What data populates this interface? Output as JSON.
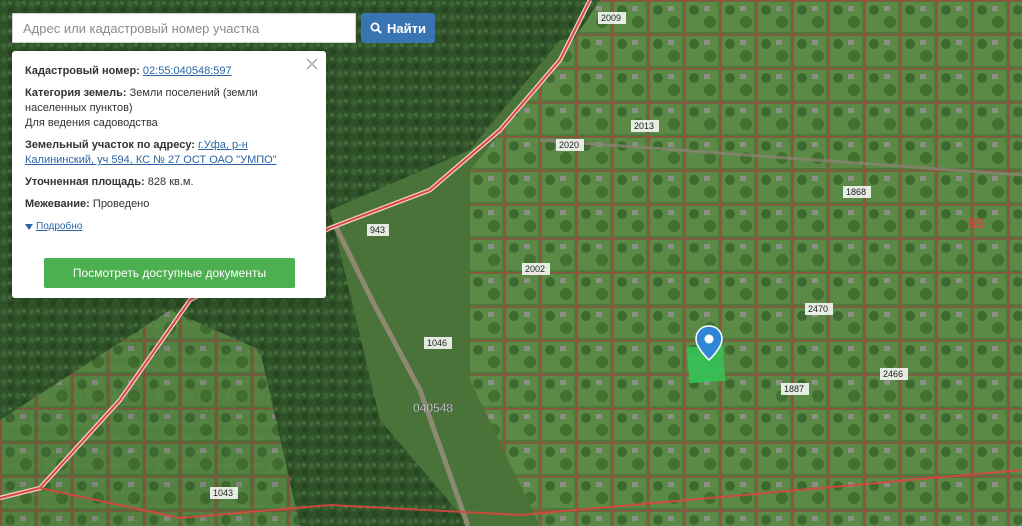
{
  "search": {
    "placeholder": "Адрес или кадастровый номер участка",
    "button_label": "Найти",
    "button_icon": "search-icon"
  },
  "panel": {
    "cadastral_label": "Кадастровый номер:",
    "cadastral_value": "02:55:040548:597",
    "category_label": "Категория земель:",
    "category_value": "Земли поселений (земли населенных пунктов)",
    "use_value": "Для ведения садоводства",
    "address_label": "Земельный участок по адресу:",
    "address_value": "г.Уфа, р-н Калининский, уч 594, КС № 27 ОСТ ОАО \"УМПО\"",
    "area_label": "Уточненная площадь:",
    "area_value": "828 кв.м.",
    "survey_label": "Межевание:",
    "survey_value": "Проведено",
    "more_label": "Подробно",
    "docs_button": "Посмотреть доступные документы",
    "close_icon": "close-icon"
  },
  "map": {
    "quarter_label": "040548",
    "district_label": "55",
    "plot_labels": [
      "2009",
      "2013",
      "2020",
      "2002",
      "1868",
      "2470",
      "1887",
      "1046",
      "943",
      "1043",
      "2466"
    ],
    "colors": {
      "boundary": "#d9463f",
      "selected_plot": "#34c759",
      "marker": "#2f86d6",
      "link": "#2a64a4",
      "button": "#4caf50",
      "search_button": "#3a75b3"
    }
  }
}
